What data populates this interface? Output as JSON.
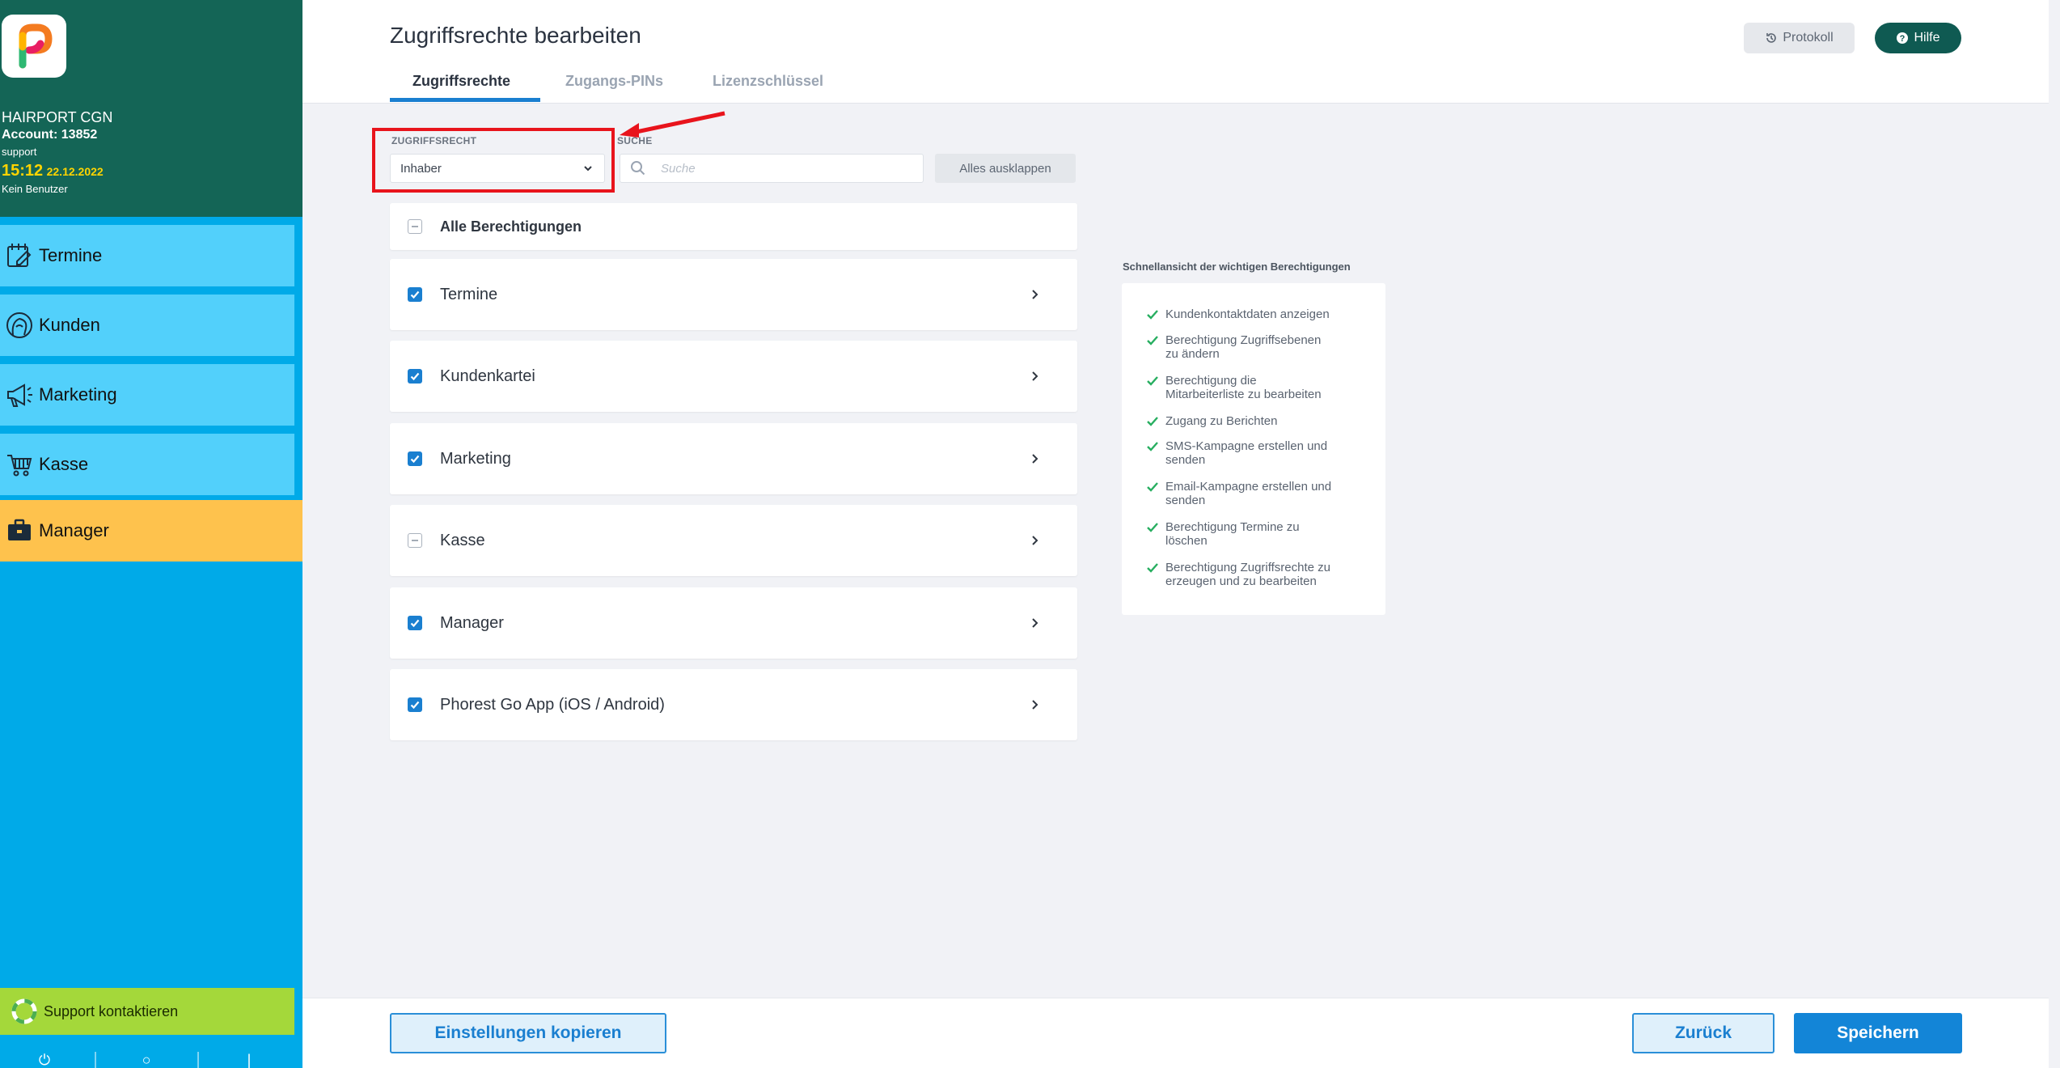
{
  "sidebar": {
    "salon": "HAIRPORT CGN",
    "account": "Account: 13852",
    "user": "support",
    "time": "15:12",
    "date": "22.12.2022",
    "no_user": "Kein Benutzer",
    "items": [
      {
        "label": "Termine",
        "icon": "calendar-edit-icon"
      },
      {
        "label": "Kunden",
        "icon": "customer-head-icon"
      },
      {
        "label": "Marketing",
        "icon": "megaphone-icon"
      },
      {
        "label": "Kasse",
        "icon": "cart-icon"
      },
      {
        "label": "Manager",
        "icon": "briefcase-icon",
        "active": true
      }
    ],
    "support_label": "Support kontaktieren",
    "accent_active": "#fec24d",
    "accent_nav": "#52d0fb"
  },
  "header": {
    "title": "Zugriffsrechte bearbeiten",
    "tabs": [
      {
        "label": "Zugriffsrechte",
        "active": true
      },
      {
        "label": "Zugangs-PINs"
      },
      {
        "label": "Lizenzschlüssel"
      }
    ],
    "protokoll_label": "Protokoll",
    "hilfe_label": "Hilfe"
  },
  "filters": {
    "role_label": "ZUGRIFFSRECHT",
    "role_value": "Inhaber",
    "search_label": "SUCHE",
    "search_placeholder": "Suche",
    "expand_label": "Alles ausklappen"
  },
  "permissions": {
    "all_label": "Alle Berechtigungen",
    "groups": [
      {
        "label": "Termine",
        "state": "checked"
      },
      {
        "label": "Kundenkartei",
        "state": "checked"
      },
      {
        "label": "Marketing",
        "state": "checked"
      },
      {
        "label": "Kasse",
        "state": "partial"
      },
      {
        "label": "Manager",
        "state": "checked"
      },
      {
        "label": "Phorest Go App (iOS / Android)",
        "state": "checked"
      }
    ]
  },
  "quick_view": {
    "title": "Schnellansicht der wichtigen Berechtigungen",
    "items": [
      {
        "line1": "Kundenkontaktdaten anzeigen",
        "line2": ""
      },
      {
        "line1": "Berechtigung Zugriffsebenen",
        "line2": "zu ändern"
      },
      {
        "line1": "Berechtigung die",
        "line2": "Mitarbeiterliste zu bearbeiten"
      },
      {
        "line1": "Zugang zu Berichten",
        "line2": ""
      },
      {
        "line1": "SMS-Kampagne erstellen und",
        "line2": "senden"
      },
      {
        "line1": "Email-Kampagne erstellen und",
        "line2": "senden"
      },
      {
        "line1": "Berechtigung Termine zu",
        "line2": "löschen"
      },
      {
        "line1": "Berechtigung Zugriffsrechte zu",
        "line2": "erzeugen und zu bearbeiten"
      }
    ]
  },
  "footer": {
    "copy_label": "Einstellungen kopieren",
    "back_label": "Zurück",
    "save_label": "Speichern"
  },
  "colors": {
    "primary": "#1385d7",
    "sidebar_head": "#146556",
    "check_green": "#27ae60",
    "highlight_red": "#e8141c"
  }
}
